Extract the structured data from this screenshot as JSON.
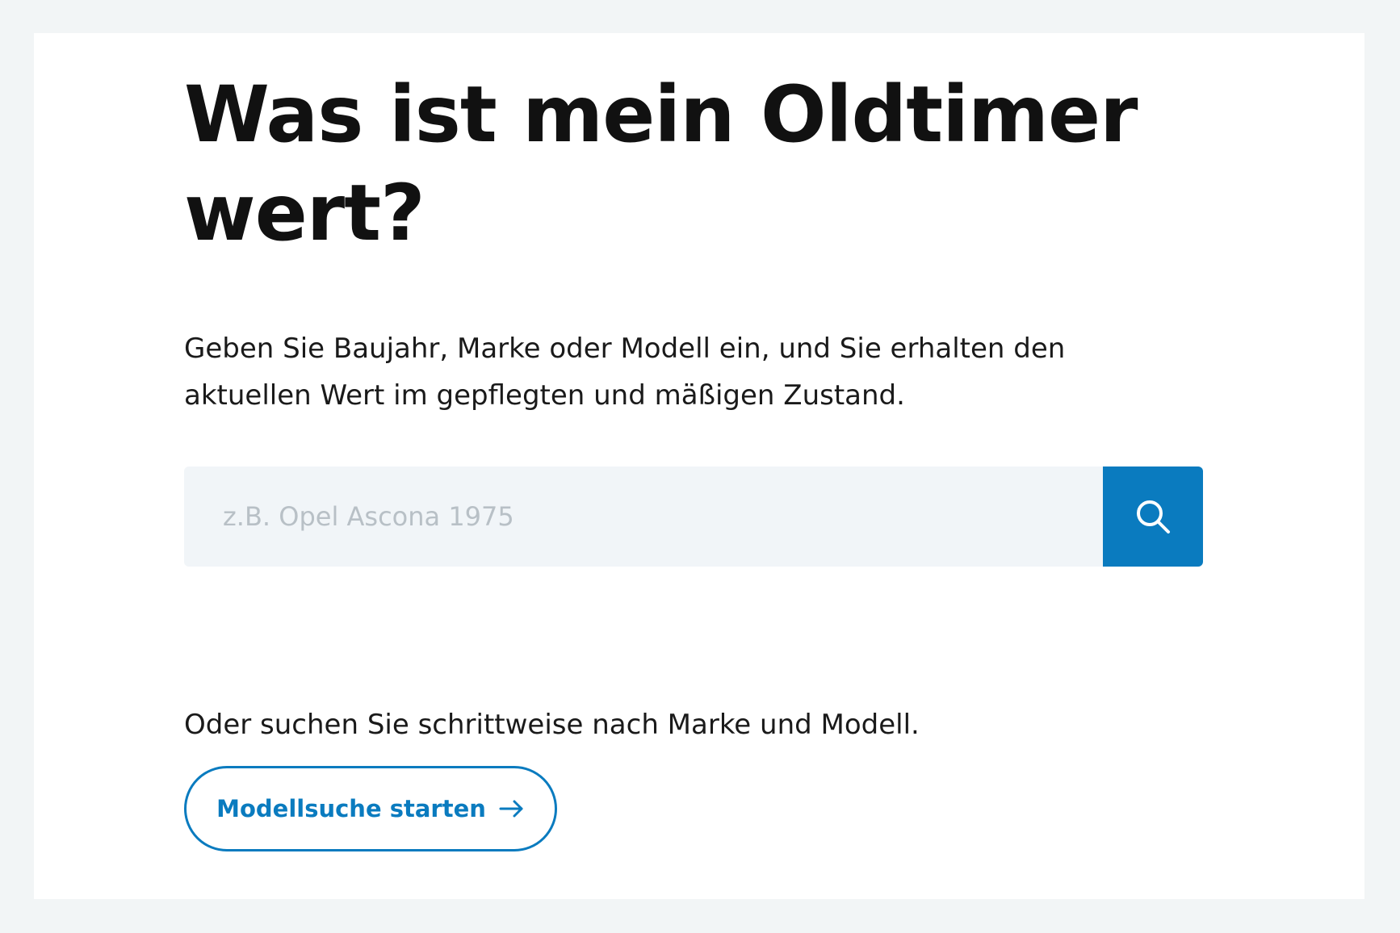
{
  "hero": {
    "title": "Was ist mein Oldtimer wert?",
    "intro": "Geben Sie Baujahr, Marke oder Modell ein, und Sie erhalten den aktuellen Wert im gepflegten und mäßigen Zustand."
  },
  "search": {
    "value": "",
    "placeholder": "z.B. Opel Ascona 1975",
    "button_icon": "search-icon",
    "button_aria_label": "Suchen"
  },
  "alternative": {
    "text": "Oder suchen Sie schrittweise nach Marke und Modell.",
    "button_label": "Modellsuche starten",
    "button_icon": "arrow-right-icon"
  },
  "colors": {
    "page_background": "#f2f5f6",
    "card_background": "#ffffff",
    "accent": "#0a7bbf",
    "input_background": "#f1f5f8",
    "text": "#111111",
    "placeholder": "#b8c0c6"
  }
}
